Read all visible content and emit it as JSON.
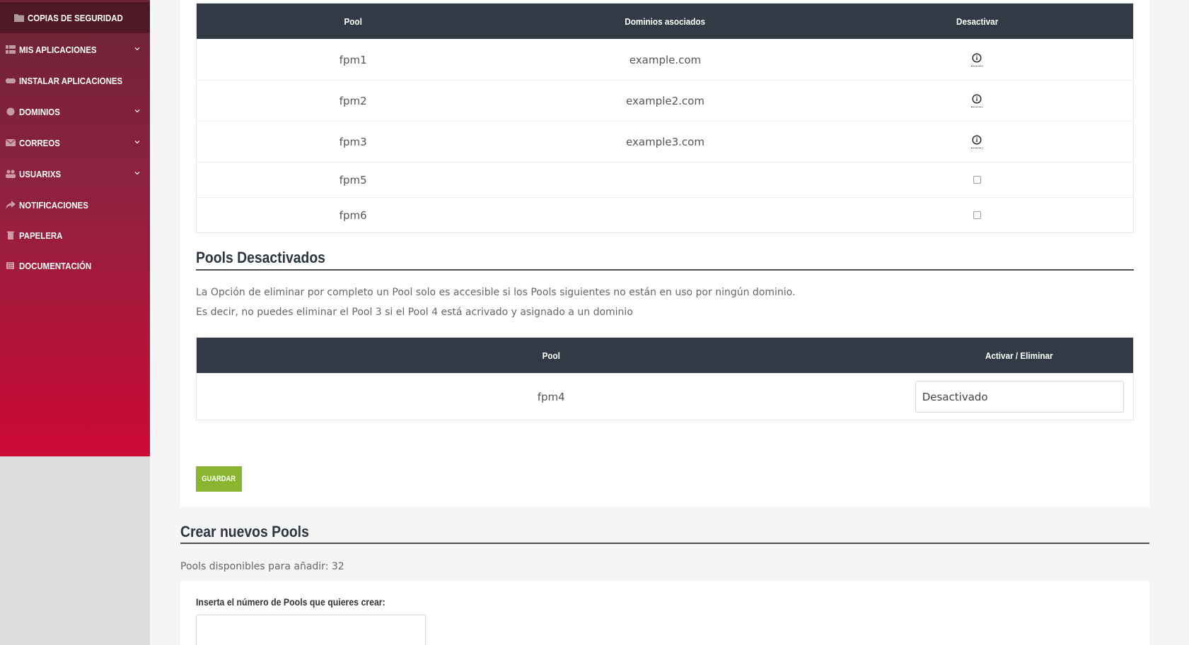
{
  "sidebar": {
    "items": [
      {
        "label": "COPIAS DE SEGURIDAD",
        "icon": "folder-icon",
        "active": true
      },
      {
        "label": "MIS APLICACIONES",
        "icon": "apps-grid-icon",
        "chevron": true
      },
      {
        "label": "INSTALAR APLICACIONES",
        "icon": "gamepad-icon"
      },
      {
        "label": "DOMINIOS",
        "icon": "globe-icon",
        "chevron": true
      },
      {
        "label": "CORREOS",
        "icon": "envelope-icon",
        "chevron": true
      },
      {
        "label": "USUARIXS",
        "icon": "users-icon",
        "chevron": true
      },
      {
        "label": "NOTIFICACIONES",
        "icon": "share-arrow-icon"
      },
      {
        "label": "PAPELERA",
        "icon": "trash-icon"
      },
      {
        "label": "DOCUMENTACIÓN",
        "icon": "book-icon"
      }
    ]
  },
  "active_pools": {
    "headers": {
      "pool": "Pool",
      "domains": "Dominios asociados",
      "deactivate": "Desactivar"
    },
    "rows": [
      {
        "pool": "fpm1",
        "domain": "example.com",
        "control": "info-icon"
      },
      {
        "pool": "fpm2",
        "domain": "example2.com",
        "control": "info-icon"
      },
      {
        "pool": "fpm3",
        "domain": "example3.com",
        "control": "info-icon"
      },
      {
        "pool": "fpm5",
        "domain": "",
        "control": "checkbox"
      },
      {
        "pool": "fpm6",
        "domain": "",
        "control": "checkbox"
      }
    ]
  },
  "deactivated": {
    "title": "Pools Desactivados",
    "line1": "La Opción de eliminar por completo un Pool solo es accesible si los Pools siguientes no están en uso por ningún dominio.",
    "line2": "Es decir, no puedes eliminar el Pool 3 si el Pool 4 está acrivado y asignado a un dominio",
    "headers": {
      "pool": "Pool",
      "action": "Activar / Eliminar"
    },
    "rows": [
      {
        "pool": "fpm4",
        "select_value": "Desactivado"
      }
    ]
  },
  "save_label": "GUARDAR",
  "create": {
    "title": "Crear nuevos Pools",
    "available": "Pools disponibles para añadir: 32",
    "input_label": "Inserta el número de Pools que quieres crear:",
    "input_value": ""
  },
  "colors": {
    "table_header": "#323b45",
    "save_button": "#8ab531",
    "sidebar_top": "#6b2334",
    "sidebar_bottom": "#cc0a35"
  }
}
